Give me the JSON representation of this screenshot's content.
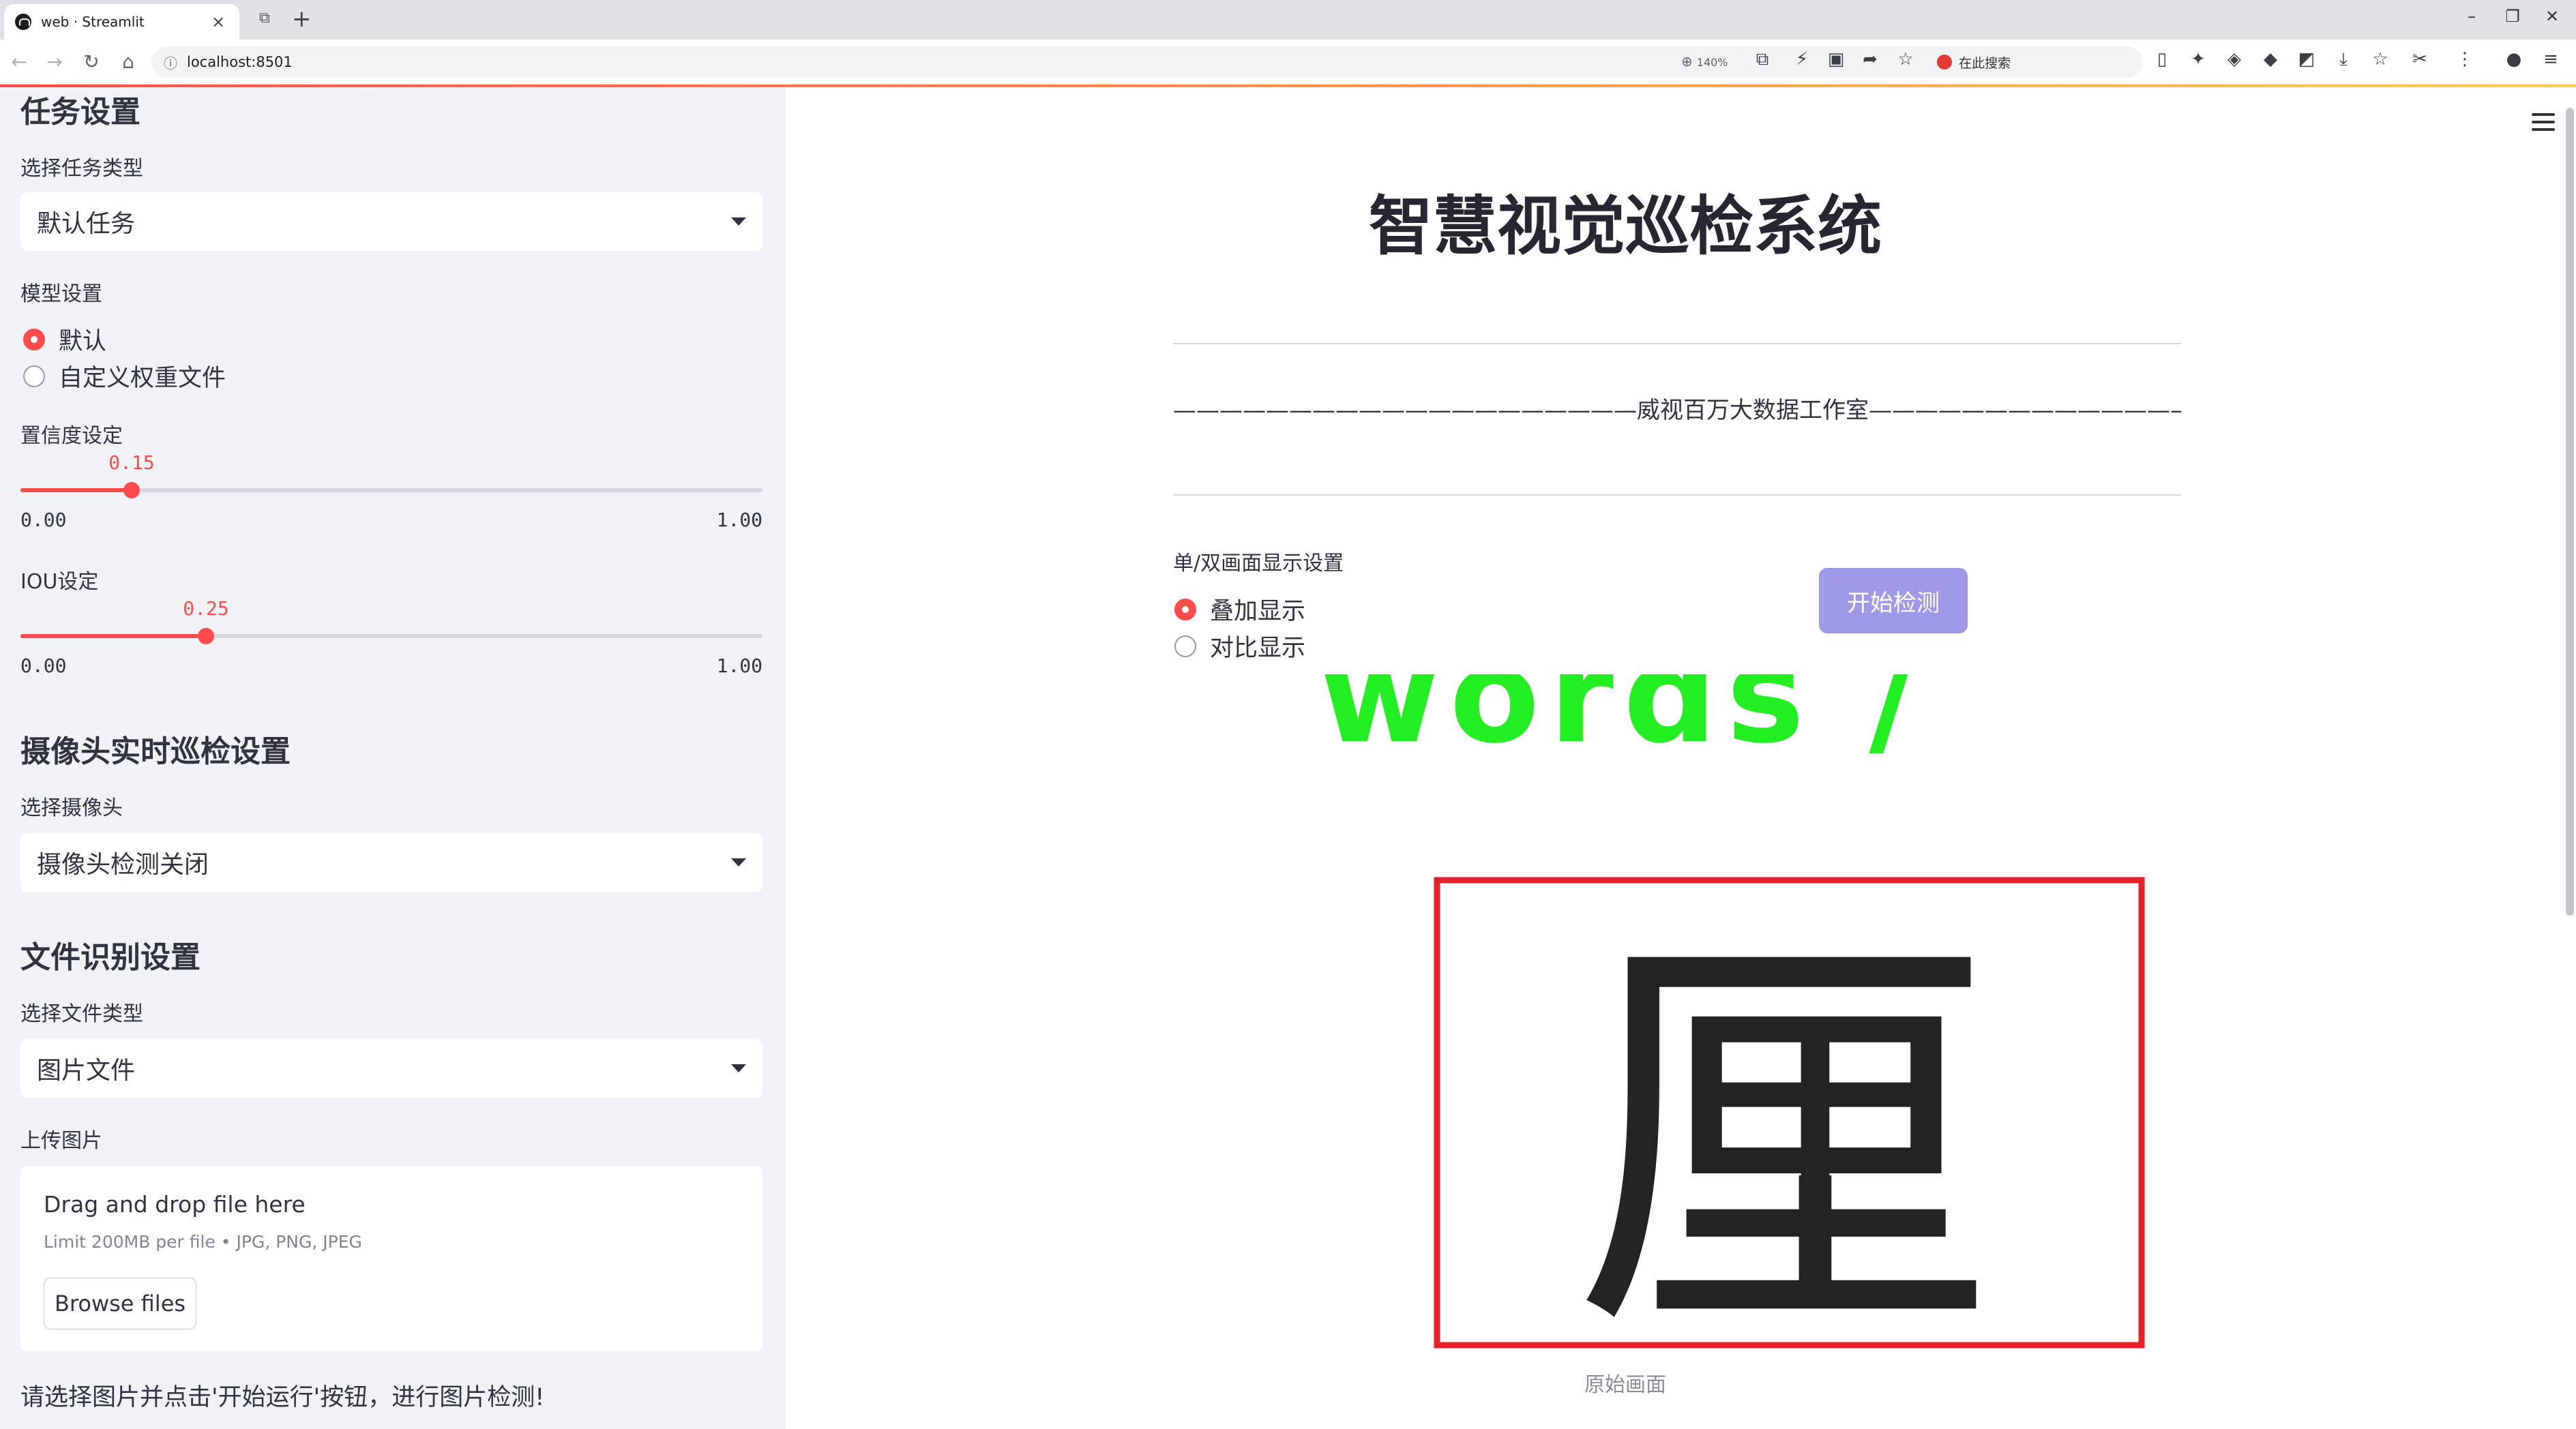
{
  "browser": {
    "tab_title": "web · Streamlit",
    "url": "localhost:8501",
    "zoom": "140%",
    "search_placeholder": "在此搜索"
  },
  "sidebar": {
    "task_heading": "任务设置",
    "task_type_label": "选择任务类型",
    "task_type_value": "默认任务",
    "model_label": "模型设置",
    "model_options": [
      "默认",
      "自定义权重文件"
    ],
    "model_selected": "默认",
    "confidence": {
      "label": "置信度设定",
      "value": "0.15",
      "min": "0.00",
      "max": "1.00",
      "fraction": 0.15
    },
    "iou": {
      "label": "IOU设定",
      "value": "0.25",
      "min": "0.00",
      "max": "1.00",
      "fraction": 0.25
    },
    "camera_heading": "摄像头实时巡检设置",
    "camera_label": "选择摄像头",
    "camera_value": "摄像头检测关闭",
    "file_heading": "文件识别设置",
    "file_type_label": "选择文件类型",
    "file_type_value": "图片文件",
    "upload_label": "上传图片",
    "upload_title": "Drag and drop file here",
    "upload_limit": "Limit 200MB per file • JPG, PNG, JPEG",
    "browse_label": "Browse files",
    "hint": "请选择图片并点击'开始运行'按钮，进行图片检测!"
  },
  "main": {
    "title": "智慧视觉巡检系统",
    "studio_line": "————————————————————威视百万大数据工作室—————————————————————",
    "display_label": "单/双画面显示设置",
    "display_options": [
      "叠加显示",
      "对比显示"
    ],
    "display_selected": "叠加显示",
    "start_button": "开始检测",
    "detection_label": "words  /",
    "image_char": "厘",
    "caption": "原始画面",
    "box_color": "#e8202a",
    "label_color": "#22ee22",
    "accent_color": "#ff4b4b"
  }
}
